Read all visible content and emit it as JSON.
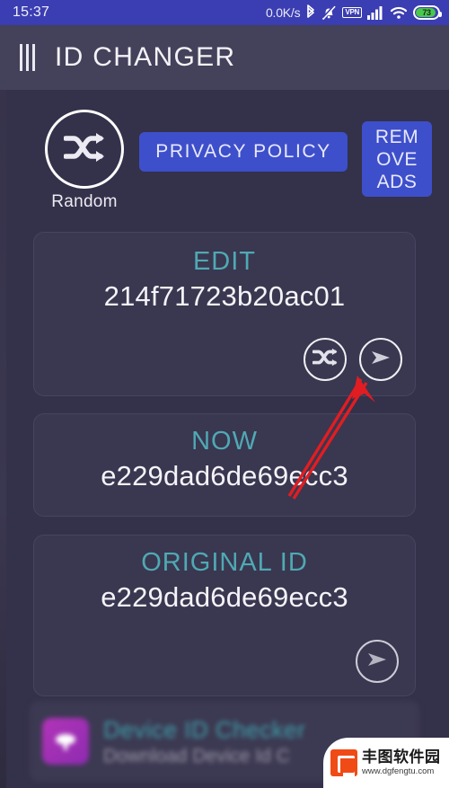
{
  "status_bar": {
    "time": "15:37",
    "network_speed": "0.0K/s",
    "icons": [
      "bluetooth-icon",
      "mute-bell-icon",
      "vpn-icon",
      "signal-icon",
      "wifi-icon",
      "battery-icon"
    ],
    "vpn_label": "VPN",
    "battery_percent": "73",
    "background_color": "#3b3db2"
  },
  "app_bar": {
    "menu_icon": "menu-bars-icon",
    "title": "ID CHANGER",
    "background_color": "#44415a"
  },
  "toolbar": {
    "random": {
      "icon": "shuffle-icon",
      "label": "Random"
    },
    "privacy_policy_label": "PRIVACY POLICY",
    "remove_ads_lines": [
      "REM",
      "OVE",
      "ADS"
    ],
    "button_color": "#3e4fcb"
  },
  "cards": [
    {
      "id": "edit",
      "title": "EDIT",
      "value": "214f71723b20ac01",
      "actions": [
        "shuffle-icon",
        "apply-play-icon"
      ]
    },
    {
      "id": "now",
      "title": "NOW",
      "value": "e229dad6de69ecc3",
      "actions": []
    },
    {
      "id": "original",
      "title": "ORIGINAL ID",
      "value": "e229dad6de69ecc3",
      "actions": [
        "apply-play-icon"
      ]
    }
  ],
  "card_style": {
    "title_color": "#4fa9b3",
    "value_color": "#f3f3f8",
    "background_color": "#3a3750"
  },
  "annotation": {
    "type": "red-arrow",
    "color": "#e11d22",
    "points_to": "edit-apply-play-button"
  },
  "ad_banner": {
    "icon": "app-icon",
    "title": "Device ID Checker",
    "subtitle": "Download Device Id C",
    "more_label": "…"
  },
  "watermark": {
    "logo": "fengtu-logo-icon",
    "name": "丰图软件园",
    "url": "www.dgfengtu.com"
  }
}
